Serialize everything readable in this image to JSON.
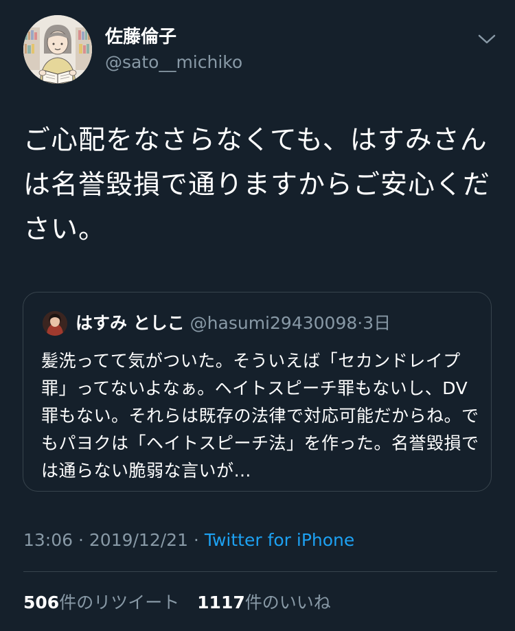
{
  "author": {
    "display_name": "佐藤倫子",
    "username": "@sato__michiko",
    "avatar_icon": "illustrated-avatar-reading-book"
  },
  "menu": {
    "icon": "chevron-down-icon"
  },
  "tweet": {
    "text": "ご心配をなさらなくても、はすみさんは名誉毀損で通りますからご安心ください。"
  },
  "quoted_tweet": {
    "display_name": "はすみ としこ",
    "username": "@hasumi29430098",
    "separator": "·",
    "time": "3日",
    "text": "髪洗ってて気がついた。そういえば「セカンドレイプ罪」ってないよなぁ。ヘイトスピーチ罪もないし、DV罪もない。それらは既存の法律で対応可能だからね。でもパヨクは「ヘイトスピーチ法」を作った。名誉毀損では通らない脆弱な言いが…"
  },
  "meta": {
    "time": "13:06",
    "separator1": " · ",
    "date": "2019/12/21",
    "separator2": " · ",
    "source": "Twitter for iPhone"
  },
  "stats": {
    "retweets_count": "506",
    "retweets_label": "件のリツイート",
    "likes_count": "1117",
    "likes_label": "件のいいね"
  },
  "colors": {
    "background": "#15202b",
    "primary_text": "#ffffff",
    "secondary_text": "#8899a6",
    "border": "#38444d",
    "link": "#1da1f2"
  }
}
